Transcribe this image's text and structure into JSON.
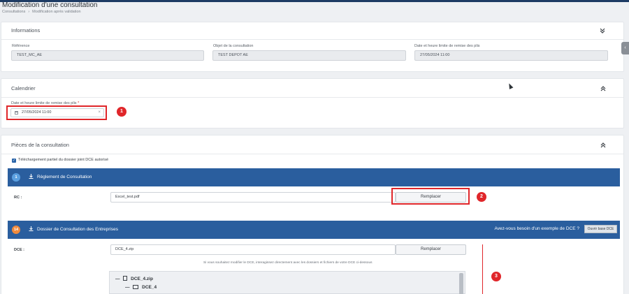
{
  "page": {
    "title": "Modification d'une consultation",
    "breadcrumb": [
      "Consultations",
      "Modification après validation"
    ],
    "breadcrumb_separator": "›"
  },
  "informations": {
    "title": "Informations",
    "fields": [
      {
        "label": "Référence",
        "value": "TEST_MC_AE"
      },
      {
        "label": "Objet de la consultation",
        "value": "TEST DEPOT AE"
      },
      {
        "label": "Date et heure limite de remise des plis",
        "value": "27/05/2024 11:00"
      }
    ]
  },
  "calendrier": {
    "title": "Calendrier",
    "date_label": "Date et heure limite de remise des plis",
    "required_mark": "*",
    "date_value": "27/05/2024 11:00"
  },
  "pieces": {
    "title": "Pièces de la consultation",
    "checkbox_label": "Téléchargement partiel du dossier joint DCE autorisé",
    "rc_section": {
      "number": "1",
      "title": "Règlement de Consultation",
      "row_label": "RC :",
      "file_name": "Excel_test.pdf",
      "replace_label": "Remplacer"
    },
    "dce_section": {
      "number": "14",
      "title": "Dossier de Consultation des Entreprises",
      "question": "Avez-vous besoin d'un exemple de DCE ?",
      "example_button": "Ouvrir base DCE",
      "row_label": "DCE :",
      "file_name": "DCE_4.zip",
      "replace_label": "Remplacer",
      "hint": "Si vous souhaitez modifier le DCE, interagissez directement avec les dossiers et fichiers de votre DCE ci-dessous",
      "tree": [
        {
          "toggle": "—",
          "name": "DCE_4.zip"
        },
        {
          "toggle": "—",
          "name": "DCE_4"
        }
      ]
    }
  },
  "annotations": [
    "1",
    "2",
    "3"
  ],
  "colors": {
    "accent_blue": "#2a5e9e",
    "annotation_red": "#e0262a",
    "badge_orange": "#f08a3c",
    "badge_light_blue": "#5a9fe0"
  },
  "icons": {
    "collapse": "chevron-double-down",
    "expand": "chevron-double-up",
    "download": "download-icon",
    "calendar": "calendar-icon"
  }
}
